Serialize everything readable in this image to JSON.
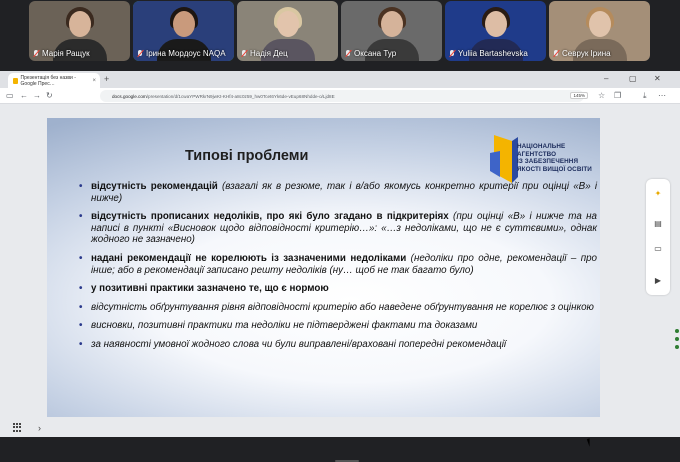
{
  "participants": [
    {
      "name": "Марія Ращук",
      "muted": true,
      "bg": "#6b6257",
      "skin": "#d7b49a",
      "hair": "#3b2a1f",
      "shirt": "#2b2b2b"
    },
    {
      "name": "Ірина Мордоус NAQA",
      "muted": true,
      "active": true,
      "bg": "#2a3f7a",
      "skin": "#c99a7c",
      "hair": "#1e1611",
      "shirt": "#1a1a1a"
    },
    {
      "name": "Надія Дец",
      "muted": true,
      "bg": "#8a8478",
      "skin": "#e2c4ac",
      "hair": "#d9c7a2",
      "shirt": "#5a5560"
    },
    {
      "name": "Оксана Тур",
      "muted": true,
      "bg": "#6a6a6a",
      "skin": "#d5b39a",
      "hair": "#4a3222",
      "shirt": "#3a3a3a"
    },
    {
      "name": "Yuliia Bartashevska",
      "muted": true,
      "bg": "#1f3b8a",
      "skin": "#ddbda5",
      "hair": "#2a1c14",
      "shirt": "#222a55"
    },
    {
      "name": "Севрук Ірина",
      "muted": true,
      "bg": "#a48f78",
      "skin": "#e0c3ab",
      "hair": "#b58b5c",
      "shirt": "#7a6a5a"
    }
  ],
  "browser": {
    "tab_title": "Презентація без назви - Google Прес…",
    "url_host": "docs.google.com",
    "url_path": "/presentation/d/1cwaYPWRkrN9jwKt-KHf4-a8c0z59_hw0Tcet6Yk6de-vEup68Nhdde-o/Ljd8E",
    "zoom": "145%"
  },
  "slide": {
    "title": "Типові проблеми",
    "logo_lines": [
      "НАЦІОНАЛЬНЕ",
      "АГЕНТСТВО",
      "ІЗ ЗАБЕЗПЕЧЕННЯ",
      "ЯКОСТІ ВИЩОЇ ОСВІТИ"
    ],
    "bullets": [
      {
        "bold": "відсутність рекомендацій",
        "italic": " (взагалі як в резюме, так і в/або якомусь конкретно критерії при оцінці «В» і нижче)"
      },
      {
        "bold": "відсутність прописаних недоліків, про які було згадано в підкритеріях",
        "italic": " (при оцінці «В» і нижче та на написі в пункті «Висновок щодо відповідності критерію…»: «…з недоліками, що не є суттєвими», однак жодного не зазначено)"
      },
      {
        "bold": "надані рекомендації не корелюють із зазначеними недоліками",
        "italic": " (недоліки про одне, рекомендації – про інше; або в рекомендації записано решту недоліків (ну… щоб не так багато було)"
      },
      {
        "bold": "у позитивні практики зазначено те, що є нормою",
        "italic": ""
      },
      {
        "bold": "",
        "italic": "відсутність обґрунтування рівня відповідності критерію або наведене обґрунтування не корелює з оцінкою"
      },
      {
        "bold": "",
        "italic": "висновки, позитивні практики та недоліки не підтверджені фактами та доказами"
      },
      {
        "bold": "",
        "italic": "за наявності умовної жодного слова чи були виправлені/враховані попередні рекомендації"
      }
    ]
  }
}
